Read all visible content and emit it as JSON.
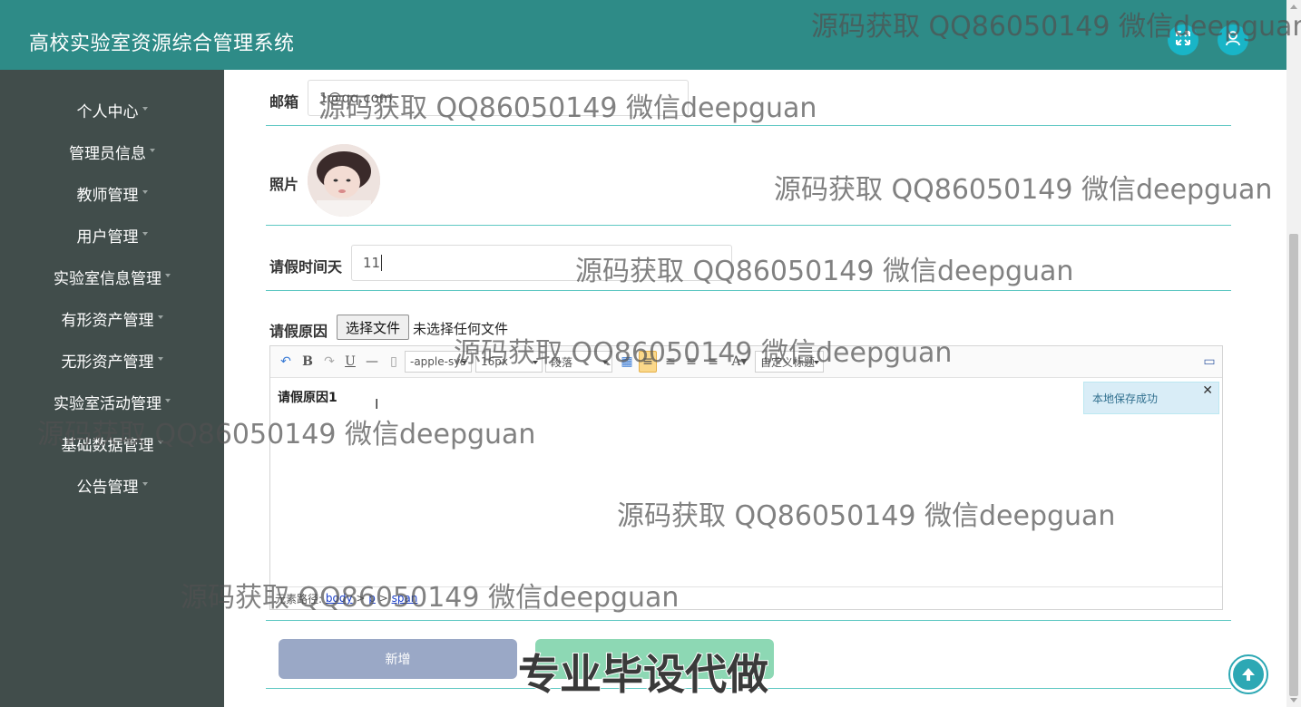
{
  "header": {
    "title": "高校实验室资源综合管理系统",
    "buttons": [
      {
        "icon": "fullscreen-icon"
      },
      {
        "icon": "user-icon"
      }
    ],
    "accent_color": "#2e8b87"
  },
  "sidebar": {
    "items": [
      {
        "label": "个人中心"
      },
      {
        "label": "管理员信息"
      },
      {
        "label": "教师管理"
      },
      {
        "label": "用户管理"
      },
      {
        "label": "实验室信息管理"
      },
      {
        "label": "有形资产管理"
      },
      {
        "label": "无形资产管理"
      },
      {
        "label": "实验室活动管理"
      },
      {
        "label": "基础数据管理"
      },
      {
        "label": "公告管理"
      }
    ]
  },
  "form": {
    "email": {
      "label": "邮箱",
      "value": "1@qq.com"
    },
    "photo": {
      "label": "照片"
    },
    "leave_days": {
      "label": "请假时间天",
      "value": "11"
    },
    "leave_reason": {
      "label": "请假原因",
      "file_button": "选择文件",
      "file_status": "未选择任何文件",
      "editor": {
        "font_family": "-apple-sys",
        "font_size": "16px",
        "paragraph": "段落",
        "custom_heading": "自定义标题",
        "content": "请假原因1",
        "toast": "本地保存成功",
        "path_label": "元素路径:",
        "path": [
          "body",
          "p",
          "span"
        ]
      }
    },
    "add_button": "新增"
  },
  "watermarks": {
    "text": "源码获取 QQ86050149 微信deepguan",
    "banner": "专业毕设代做"
  }
}
